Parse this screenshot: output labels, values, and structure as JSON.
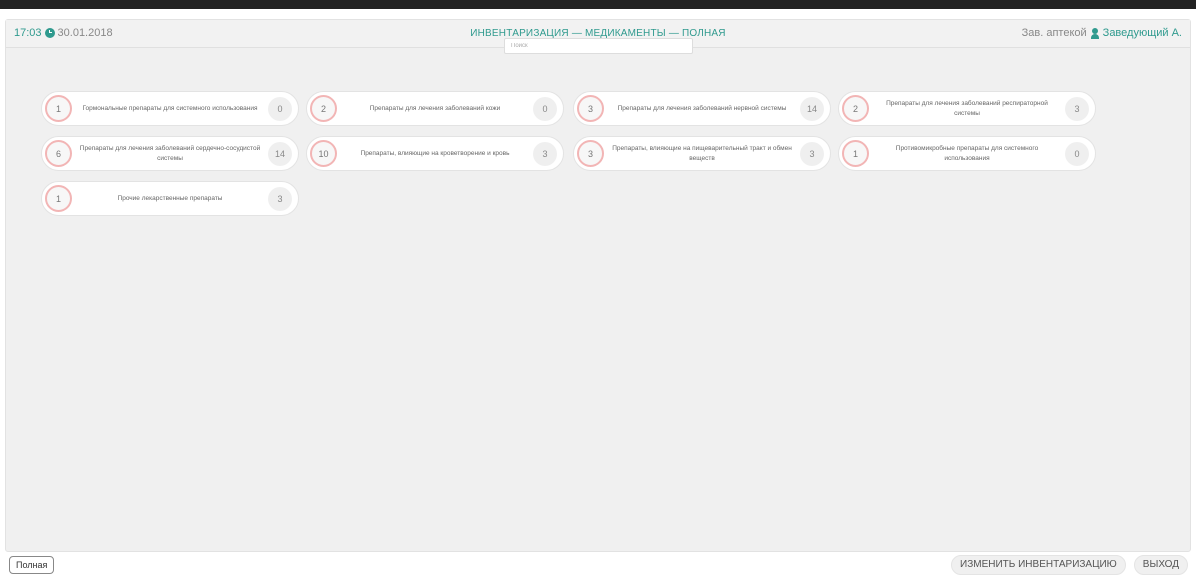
{
  "header": {
    "time": "17:03",
    "date": "30.01.2018",
    "title": "ИНВЕНТАРИЗАЦИЯ — МЕДИКАМЕНТЫ — ПОЛНАЯ",
    "role": "Зав. аптекой",
    "user": "Заведующий А."
  },
  "search": {
    "placeholder": "Поиск"
  },
  "categories": [
    {
      "count": "1",
      "label": "Гормональные препараты для системного использования",
      "total": "0"
    },
    {
      "count": "2",
      "label": "Препараты для лечения заболеваний кожи",
      "total": "0"
    },
    {
      "count": "3",
      "label": "Препараты для лечения заболеваний нервной системы",
      "total": "14"
    },
    {
      "count": "2",
      "label": "Препараты для лечения заболеваний респираторной системы",
      "total": "3"
    },
    {
      "count": "6",
      "label": "Препараты для лечения заболеваний сердечно-сосудистой системы",
      "total": "14"
    },
    {
      "count": "10",
      "label": "Препараты, влияющие на кроветворение и кровь",
      "total": "3"
    },
    {
      "count": "3",
      "label": "Препараты, влияющие на пищеварительный тракт и обмен веществ",
      "total": "3"
    },
    {
      "count": "1",
      "label": "Противомикробные препараты для системного использования",
      "total": "0"
    },
    {
      "count": "1",
      "label": "Прочие лекарственные препараты",
      "total": "3"
    }
  ],
  "footer": {
    "mode_label": "Полная",
    "change_label": "ИЗМЕНИТЬ ИНВЕНТАРИЗАЦИЮ",
    "exit_label": "ВЫХОД"
  },
  "colors": {
    "accent": "#2f9a8e",
    "count_ring": "#f2b5b5",
    "background": "#f0f0f0"
  }
}
